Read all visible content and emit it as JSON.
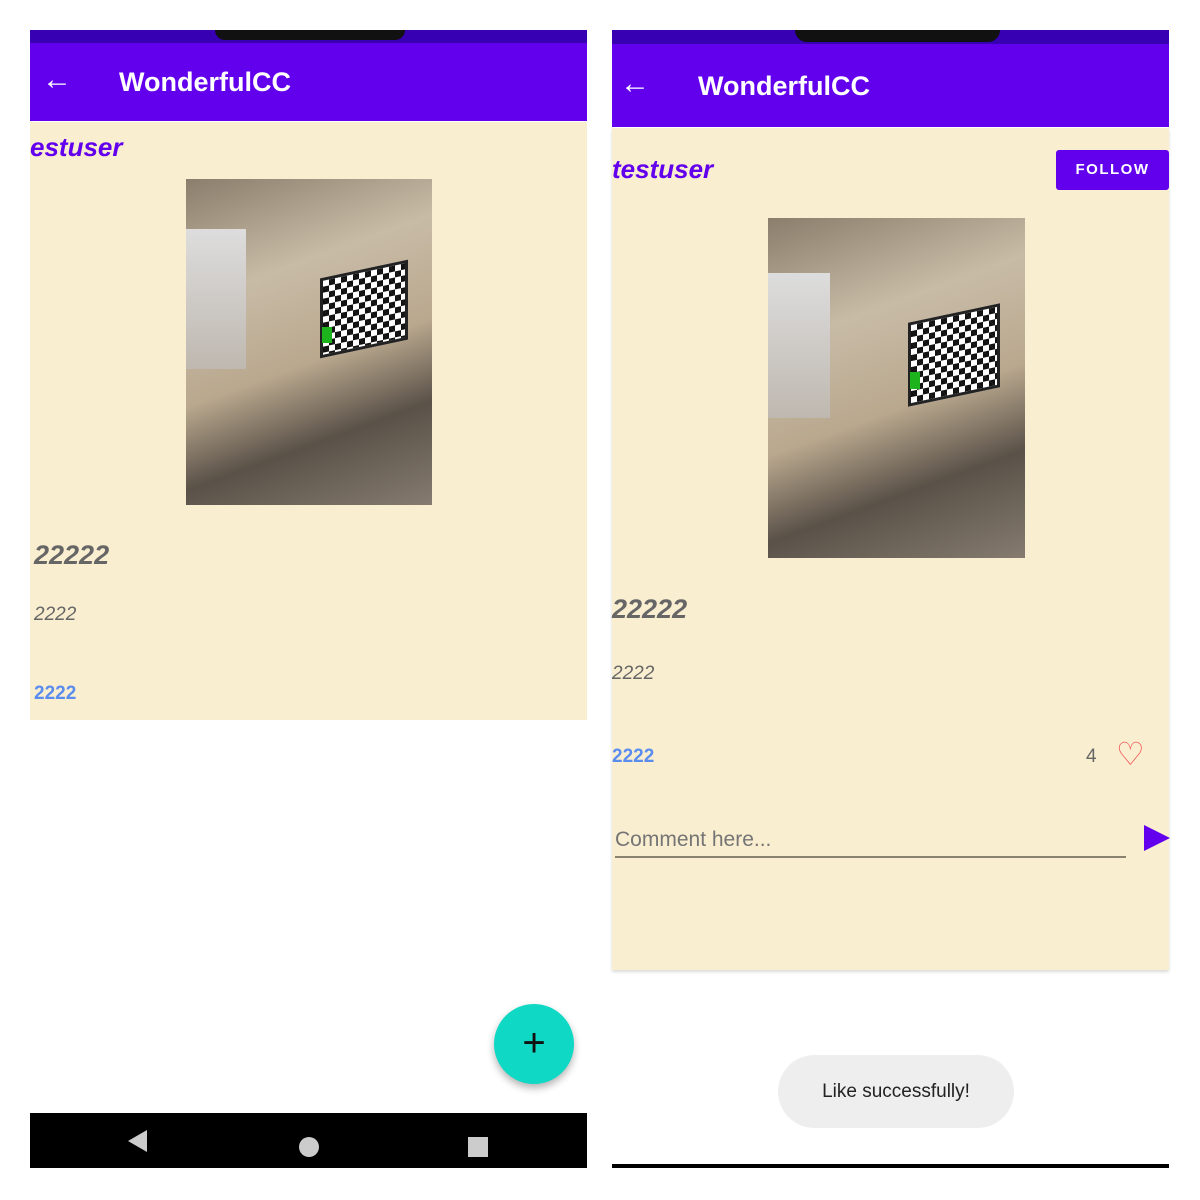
{
  "left": {
    "app_title": "WonderfulCC",
    "username": "estuser",
    "post_title": "22222",
    "post_body": "2222",
    "post_link": "2222",
    "fab_label": "+"
  },
  "right": {
    "app_title": "WonderfulCC",
    "username": "testuser",
    "follow_label": "FOLLOW",
    "post_title": "22222",
    "post_body": "2222",
    "post_link": "2222",
    "like_count": "4",
    "comment_placeholder": "Comment here...",
    "toast": "Like successfully!"
  },
  "colors": {
    "primary": "#6200EE",
    "background": "#FAEED0",
    "fab": "#0FD8C4",
    "heart": "#F05A5A",
    "link": "#5B8DEF"
  }
}
